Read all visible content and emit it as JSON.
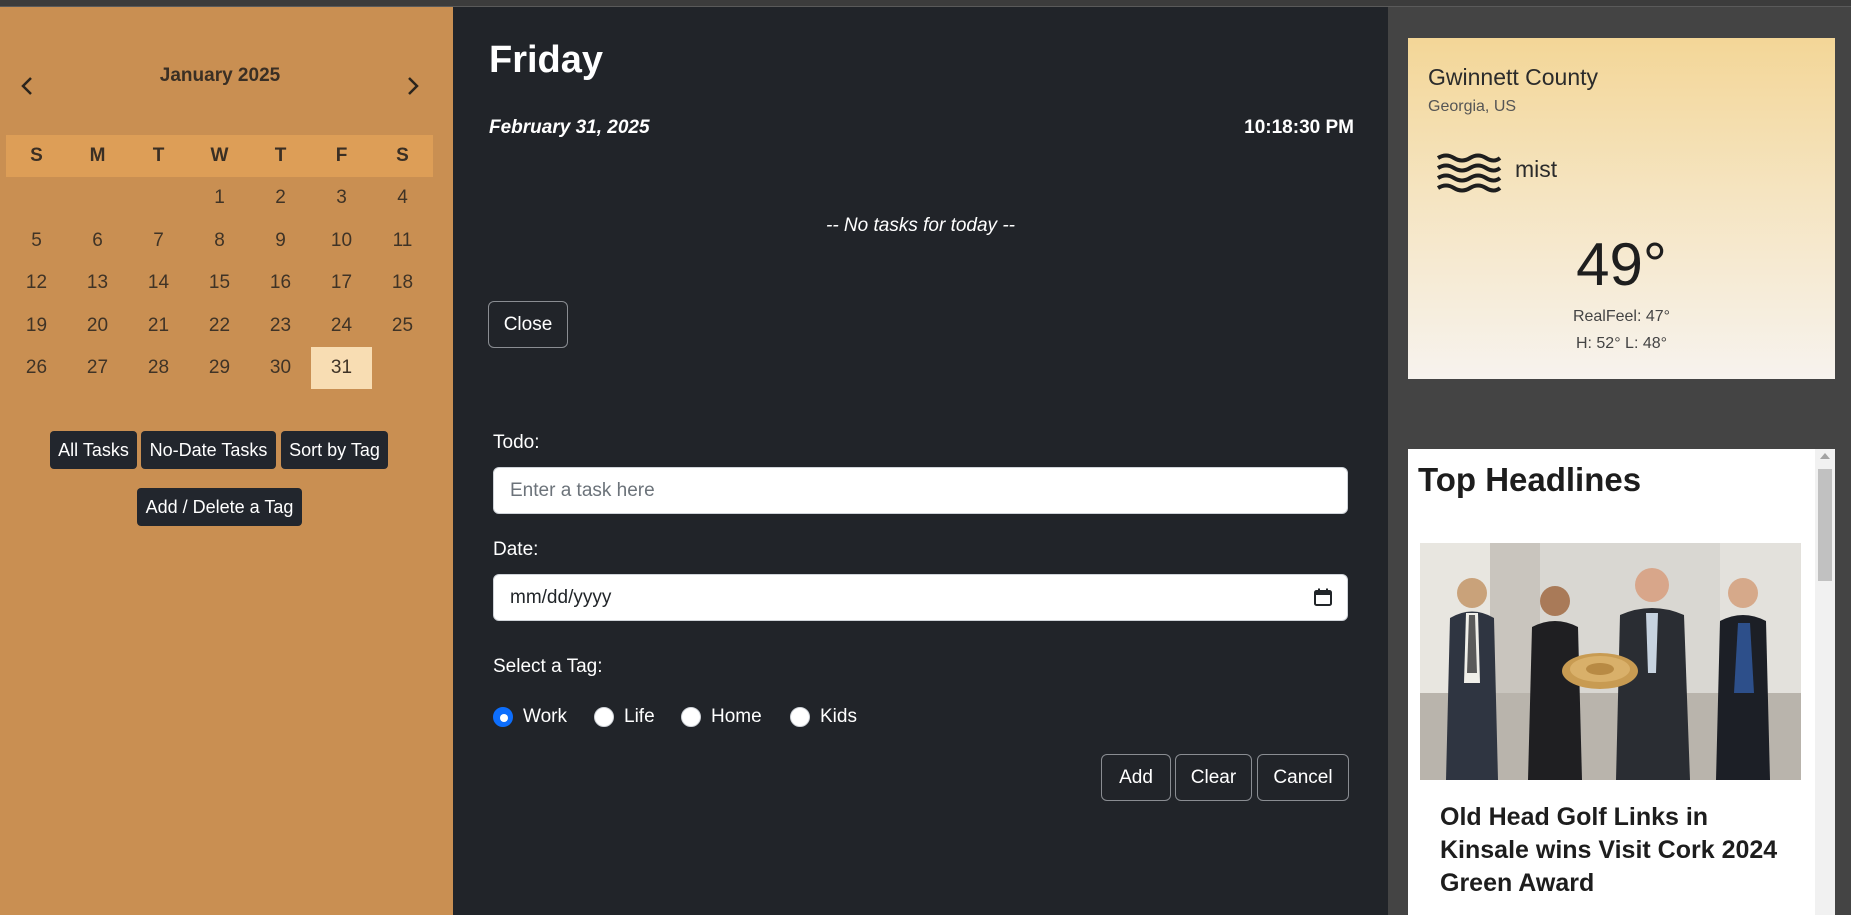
{
  "calendar": {
    "month_title": "January 2025",
    "day_headers": [
      "S",
      "M",
      "T",
      "W",
      "T",
      "F",
      "S"
    ],
    "weeks": [
      [
        "",
        "",
        "",
        "1",
        "2",
        "3",
        "4"
      ],
      [
        "5",
        "6",
        "7",
        "8",
        "9",
        "10",
        "11"
      ],
      [
        "12",
        "13",
        "14",
        "15",
        "16",
        "17",
        "18"
      ],
      [
        "19",
        "20",
        "21",
        "22",
        "23",
        "24",
        "25"
      ],
      [
        "26",
        "27",
        "28",
        "29",
        "30",
        "31",
        ""
      ]
    ],
    "highlighted_day": "31",
    "buttons": {
      "all_tasks": "All Tasks",
      "no_date_tasks": "No-Date Tasks",
      "sort_by_tag": "Sort by Tag",
      "add_delete_tag": "Add / Delete a Tag"
    }
  },
  "day_view": {
    "day_name": "Friday",
    "date": "February 31, 2025",
    "time": "10:18:30 PM",
    "empty_message": "-- No tasks for today --",
    "close_label": "Close"
  },
  "form": {
    "todo_label": "Todo:",
    "todo_placeholder": "Enter a task here",
    "date_label": "Date:",
    "date_placeholder": "mm/dd/yyyy",
    "tag_label": "Select a Tag:",
    "tags": [
      {
        "label": "Work",
        "checked": true
      },
      {
        "label": "Life",
        "checked": false
      },
      {
        "label": "Home",
        "checked": false
      },
      {
        "label": "Kids",
        "checked": false
      }
    ],
    "add_label": "Add",
    "clear_label": "Clear",
    "cancel_label": "Cancel"
  },
  "weather": {
    "city": "Gwinnett County",
    "region": "Georgia, US",
    "condition": "mist",
    "condition_icon": "mist-icon",
    "temperature": "49°",
    "realfeel": "RealFeel: 47°",
    "high_low": "H: 52° L: 48°"
  },
  "news": {
    "title": "Top Headlines",
    "headline": "Old Head Golf Links in Kinsale wins Visit Cork 2024 Green Award"
  },
  "colors": {
    "calendar_bg": "#c98f52",
    "calendar_header_bg": "#dd9e57",
    "today_bg": "#f8ddb3",
    "dark_bg": "#212429",
    "accent": "#0d6efd"
  }
}
